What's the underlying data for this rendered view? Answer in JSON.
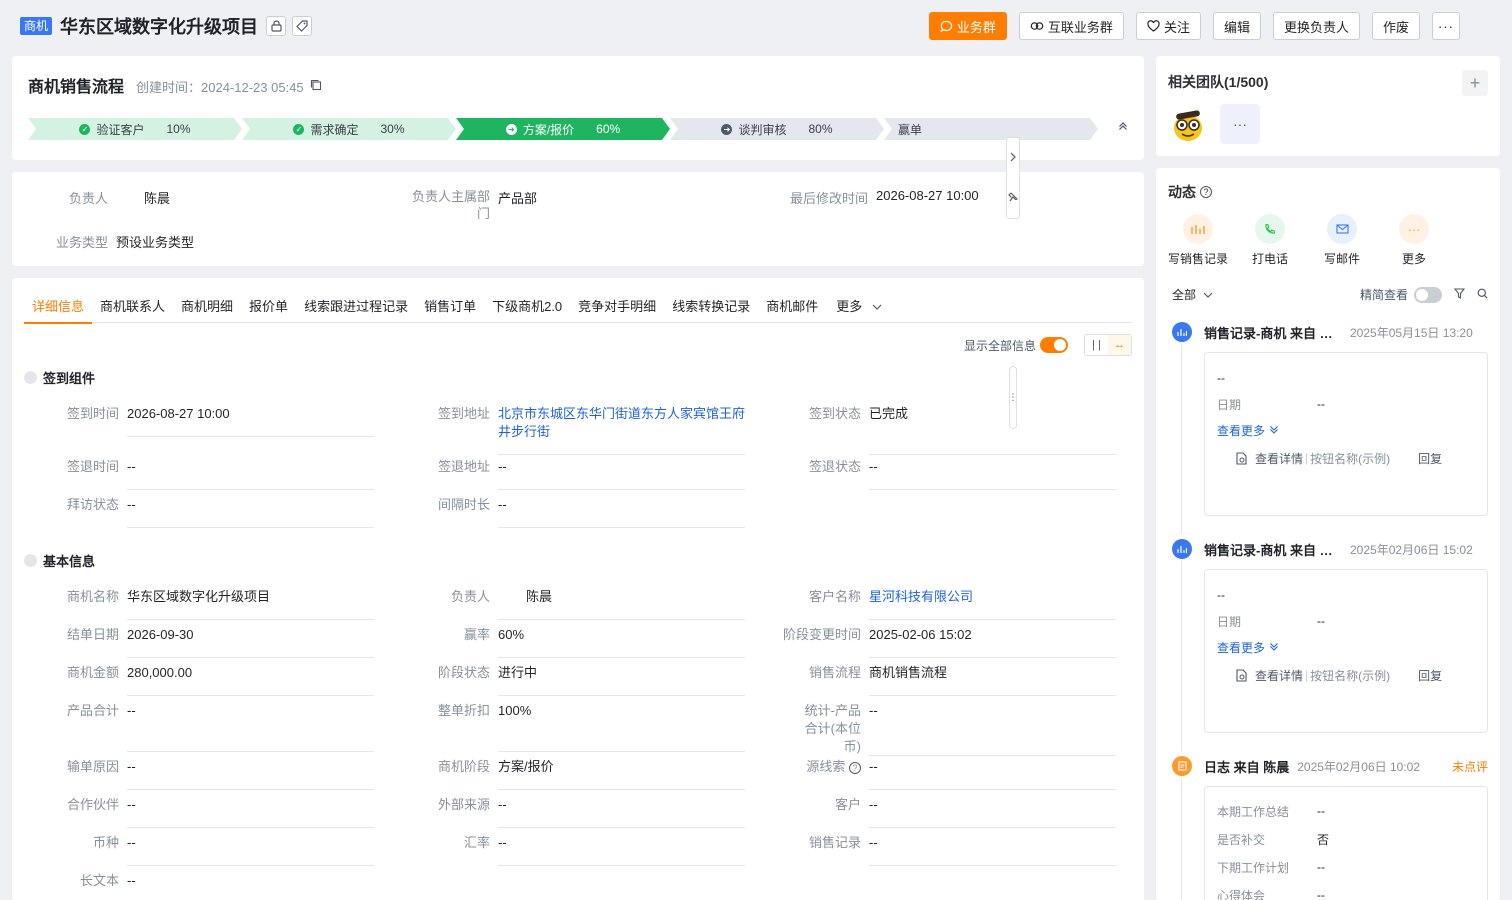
{
  "header": {
    "badge": "商机",
    "title": "华东区域数字化升级项目",
    "actions": {
      "biz_group": "业务群",
      "interconnect_group": "互联业务群",
      "follow": "关注",
      "edit": "编辑",
      "change_owner": "更换负责人",
      "void": "作废",
      "more": "···"
    }
  },
  "stage_card": {
    "title": "商机销售流程",
    "created": "创建时间：2024-12-23 05:45",
    "stages": [
      {
        "name": "验证客户",
        "pct": "10%"
      },
      {
        "name": "需求确定",
        "pct": "30%"
      },
      {
        "name": "方案/报价",
        "pct": "60%"
      },
      {
        "name": "谈判审核",
        "pct": "80%"
      },
      {
        "name": "赢单",
        "pct": ""
      }
    ]
  },
  "owner_card": {
    "owner_label": "负责人",
    "owner_value": "陈晨",
    "dept_label": "负责人主属部门",
    "dept_value": "产品部",
    "modified_label": "最后修改时间",
    "modified_value": "2026-08-27 10:00",
    "biztype_label": "业务类型",
    "biztype_value": "预设业务类型"
  },
  "tabs": [
    "详细信息",
    "商机联系人",
    "商机明细",
    "报价单",
    "线索跟进过程记录",
    "销售订单",
    "下级商机2.0",
    "竞争对手明细",
    "线索转换记录",
    "商机邮件"
  ],
  "tab_more": "更多",
  "show_all_label": "显示全部信息",
  "sections": {
    "checkin": "签到组件",
    "basic": "基本信息"
  },
  "checkin_fields": {
    "checkin_time": {
      "k": "签到时间",
      "v": "2026-08-27 10:00"
    },
    "checkin_addr": {
      "k": "签到地址",
      "v": "北京市东城区东华门街道东方人家宾馆王府井步行街"
    },
    "checkin_status": {
      "k": "签到状态",
      "v": "已完成"
    },
    "checkout_time": {
      "k": "签退时间",
      "v": "--"
    },
    "checkout_addr": {
      "k": "签退地址",
      "v": "--"
    },
    "checkout_status": {
      "k": "签退状态",
      "v": "--"
    },
    "visit_status": {
      "k": "拜访状态",
      "v": "--"
    },
    "interval": {
      "k": "间隔时长",
      "v": "--"
    }
  },
  "basic_fields": {
    "opp_name": {
      "k": "商机名称",
      "v": "华东区域数字化升级项目"
    },
    "owner": {
      "k": "负责人",
      "v": "陈晨"
    },
    "customer": {
      "k": "客户名称",
      "v": "星河科技有限公司"
    },
    "close_date": {
      "k": "结单日期",
      "v": "2026-09-30"
    },
    "win_rate": {
      "k": "赢率",
      "v": "60%"
    },
    "stage_change": {
      "k": "阶段变更时间",
      "v": "2025-02-06 15:02"
    },
    "amount": {
      "k": "商机金额",
      "v": "280,000.00"
    },
    "stage_status": {
      "k": "阶段状态",
      "v": "进行中"
    },
    "sales_flow": {
      "k": "销售流程",
      "v": "商机销售流程"
    },
    "product_total": {
      "k": "产品合计",
      "v": "--"
    },
    "discount": {
      "k": "整单折扣",
      "v": "100%"
    },
    "stat_total": {
      "k": "统计-产品合计(本位币)",
      "v": "--"
    },
    "loss_reason": {
      "k": "输单原因",
      "v": "--"
    },
    "opp_stage": {
      "k": "商机阶段",
      "v": "方案/报价"
    },
    "lead_source": {
      "k": "源线索",
      "v": "--"
    },
    "partner": {
      "k": "合作伙伴",
      "v": "--"
    },
    "ext_source": {
      "k": "外部来源",
      "v": "--"
    },
    "client": {
      "k": "客户",
      "v": "--"
    },
    "currency": {
      "k": "币种",
      "v": "--"
    },
    "exchange_rate": {
      "k": "汇率",
      "v": "--"
    },
    "sales_record": {
      "k": "销售记录",
      "v": "--"
    },
    "long_text": {
      "k": "长文本",
      "v": "--"
    }
  },
  "team": {
    "title": "相关团队(1/500)",
    "add": "+",
    "more": "···"
  },
  "feed": {
    "title": "动态",
    "quick": [
      {
        "label": "写销售记录",
        "icon": "chart-icon",
        "color": "#ff9a2e"
      },
      {
        "label": "打电话",
        "icon": "phone-icon",
        "color": "#23c343"
      },
      {
        "label": "写邮件",
        "icon": "mail-icon",
        "color": "#3a78f2"
      },
      {
        "label": "更多",
        "icon": "more-icon",
        "color": "#ff9a2e"
      }
    ],
    "filter_all": "全部",
    "brief": "精简查看",
    "items": [
      {
        "title": "销售记录-商机 来自 陈晨",
        "time": "2025年05月15日 13:20",
        "line1": "--",
        "date_label": "日期",
        "date_value": "--",
        "more": "查看更多",
        "detail": "查看详情",
        "btn": "按钮名称(示例)",
        "reply": "回复"
      },
      {
        "title": "销售记录-商机 来自 陈晨",
        "time": "2025年02月06日 15:02",
        "line1": "--",
        "date_label": "日期",
        "date_value": "--",
        "more": "查看更多",
        "detail": "查看详情",
        "btn": "按钮名称(示例)",
        "reply": "回复"
      }
    ],
    "log": {
      "title": "日志 来自 陈晨",
      "time": "2025年02月06日 10:02",
      "tag": "未点评",
      "rows": [
        {
          "k": "本期工作总结",
          "v": "--"
        },
        {
          "k": "是否补交",
          "v": "否"
        },
        {
          "k": "下期工作计划",
          "v": "--"
        },
        {
          "k": "心得体会",
          "v": "--"
        }
      ]
    }
  }
}
